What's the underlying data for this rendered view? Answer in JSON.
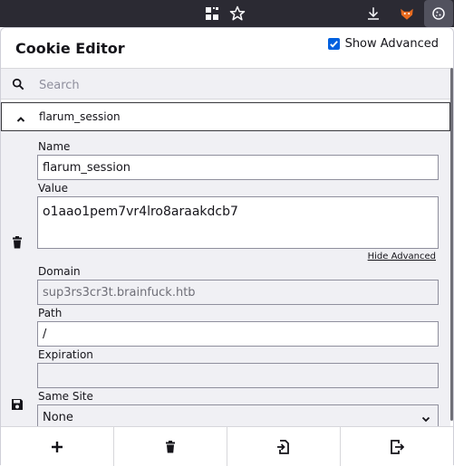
{
  "browser": {
    "icons": [
      "extensions-grid-icon",
      "bookmark-star-icon",
      "downloads-icon",
      "extension-fox-icon",
      "cookie-editor-icon"
    ]
  },
  "popup": {
    "title": "Cookie Editor",
    "show_advanced_label": "Show Advanced",
    "show_advanced_checked": true
  },
  "search": {
    "placeholder": "Search"
  },
  "cookie": {
    "name_header": "flarum_session",
    "name_label": "Name",
    "name_value": "flarum_session",
    "value_label": "Value",
    "value": "o1aao1pem7vr4lro8araakdcb7",
    "hide_advanced": "Hide Advanced",
    "domain_label": "Domain",
    "domain_value": "sup3rs3cr3t.brainfuck.htb",
    "path_label": "Path",
    "path_value": "/",
    "expiration_label": "Expiration",
    "expiration_value": "",
    "same_site_label": "Same Site",
    "same_site_value": "None"
  },
  "colors": {
    "accent": "#0060df",
    "toolbar": "#2b2a33"
  }
}
